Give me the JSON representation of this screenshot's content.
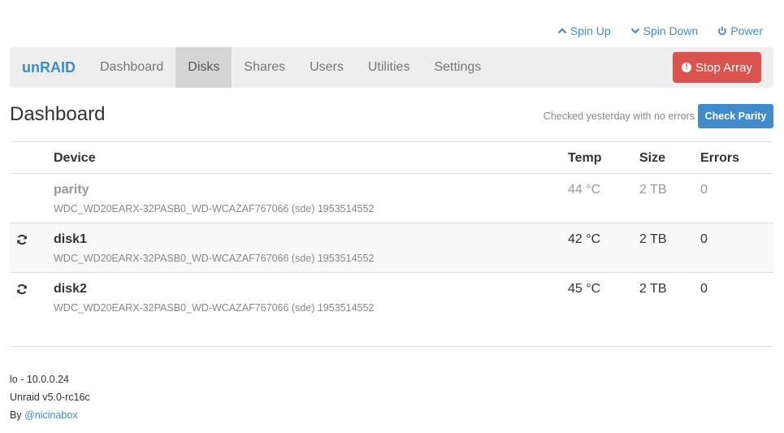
{
  "topbar": {
    "spin_up": "Spin Up",
    "spin_down": "Spin Down",
    "power": "Power"
  },
  "navbar": {
    "brand": "unRAID",
    "items": [
      "Dashboard",
      "Disks",
      "Shares",
      "Users",
      "Utilities",
      "Settings"
    ],
    "active": "Disks",
    "stop_array": "Stop Array"
  },
  "page": {
    "title": "Dashboard",
    "parity_status": "Checked yesterday with no errors",
    "check_parity": "Check Parity"
  },
  "table": {
    "headers": {
      "device": "Device",
      "temp": "Temp",
      "size": "Size",
      "errors": "Errors"
    },
    "rows": [
      {
        "name": "parity",
        "model": "WDC_WD20EARX-32PASB0_WD-WCAZAF767066 (sde) 1953514552",
        "temp": "44 °C",
        "size": "2 TB",
        "errors": "0",
        "icon": ""
      },
      {
        "name": "disk1",
        "model": "WDC_WD20EARX-32PASB0_WD-WCAZAF767066 (sde) 1953514552",
        "temp": "42 °C",
        "size": "2 TB",
        "errors": "0",
        "icon": "refresh-icon"
      },
      {
        "name": "disk2",
        "model": "WDC_WD20EARX-32PASB0_WD-WCAZAF767066 (sde) 1953514552",
        "temp": "45 °C",
        "size": "2 TB",
        "errors": "0",
        "icon": "refresh-icon"
      }
    ]
  },
  "footer": {
    "host": "lo - 10.0.0.24",
    "version": "Unraid v5.0-rc16c",
    "by_prefix": "By",
    "author": "@nicinabox"
  },
  "colors": {
    "accent": "#428bca",
    "danger": "#d9534f",
    "navbar_bg": "#eeeeee"
  }
}
